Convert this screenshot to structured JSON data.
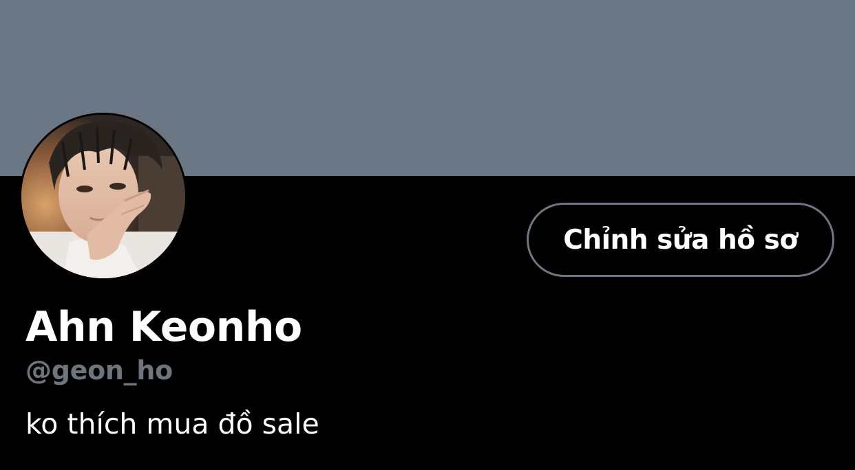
{
  "profile": {
    "display_name": "Ahn Keonho",
    "handle": "@geon_ho",
    "bio": "ko thích mua đồ sale",
    "edit_button_label": "Chỉnh sửa hồ sơ"
  },
  "colors": {
    "banner": "#6b7784",
    "background": "#000000",
    "text_primary": "#ffffff",
    "text_secondary": "#6e767d",
    "button_border": "#6e7781"
  }
}
